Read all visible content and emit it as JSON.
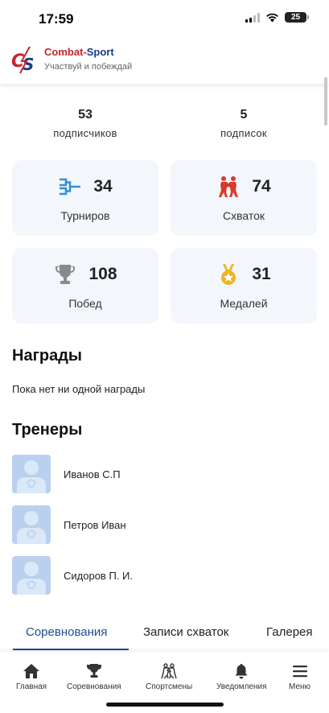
{
  "status_bar": {
    "time": "17:59",
    "battery": "25"
  },
  "header": {
    "brand_part1": "Combat-",
    "brand_part2": "Sport",
    "slogan": "Участвуй и побеждай",
    "logo_text": "CS"
  },
  "counters": [
    {
      "value": "53",
      "label": "подписчиков"
    },
    {
      "value": "5",
      "label": "подписок"
    }
  ],
  "stats": [
    {
      "value": "34",
      "label": "Турниров",
      "icon": "bracket-icon",
      "color": "#2f8fd8"
    },
    {
      "value": "74",
      "label": "Схваток",
      "icon": "wrestlers-icon",
      "color": "#d93a2b"
    },
    {
      "value": "108",
      "label": "Побед",
      "icon": "trophy-icon",
      "color": "#8a8a8a"
    },
    {
      "value": "31",
      "label": "Медалей",
      "icon": "medal-icon",
      "color": "#f0b323"
    }
  ],
  "awards": {
    "title": "Награды",
    "empty_text": "Пока нет ни одной награды"
  },
  "coaches": {
    "title": "Тренеры",
    "items": [
      "Иванов С.П",
      "Петров Иван",
      "Сидоров П. И."
    ]
  },
  "tabs": [
    "Соревнования",
    "Записи схваток",
    "Галерея"
  ],
  "bottom_nav": [
    {
      "label": "Главная",
      "icon": "home-icon"
    },
    {
      "label": "Соревнования",
      "icon": "trophy-icon"
    },
    {
      "label": "Спортсмены",
      "icon": "wrestlers-icon"
    },
    {
      "label": "Уведомления",
      "icon": "bell-icon"
    },
    {
      "label": "Меню",
      "icon": "menu-icon"
    }
  ],
  "colors": {
    "accent": "#1f4d8c",
    "card_bg": "#f3f6fb",
    "brand_red": "#c4262d",
    "brand_blue": "#1b3a8a"
  }
}
